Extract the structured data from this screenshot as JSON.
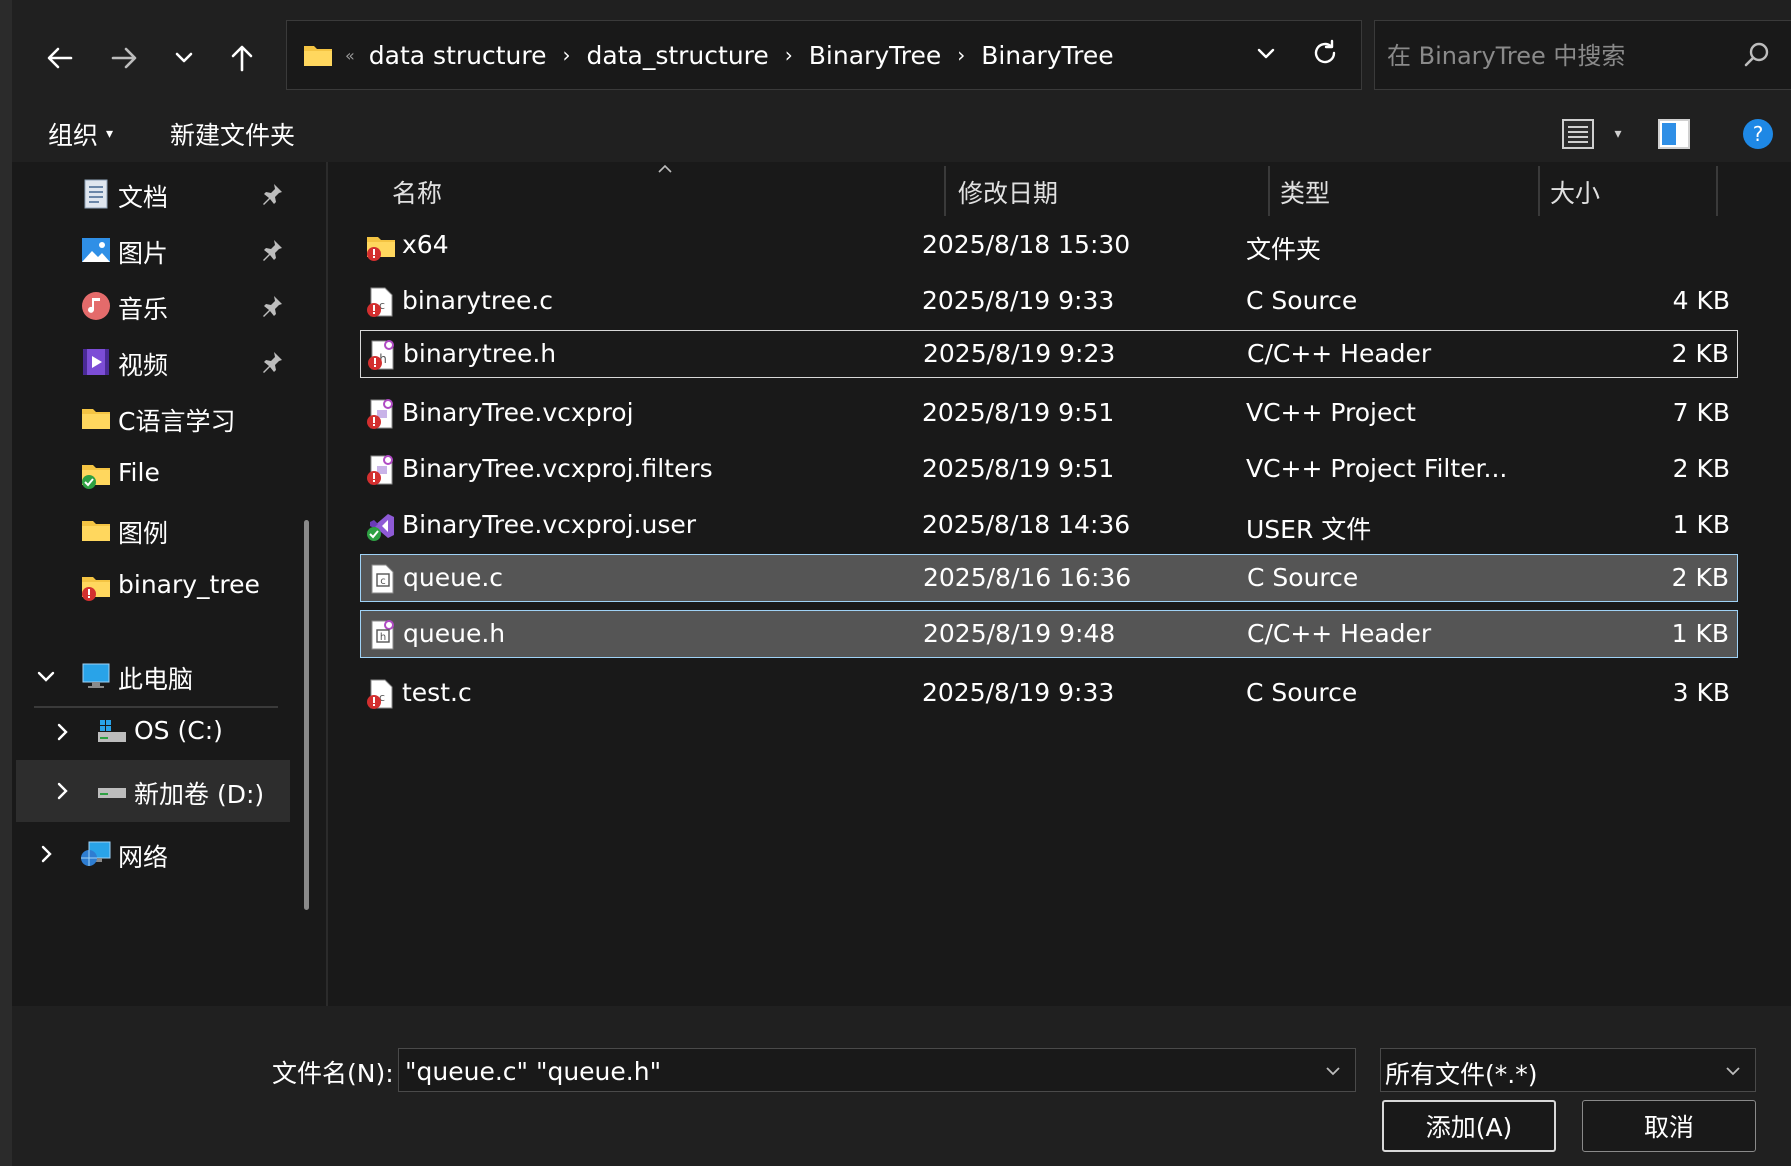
{
  "address": {
    "overflow": "«",
    "crumbs": [
      "data structure",
      "data_structure",
      "BinaryTree",
      "BinaryTree"
    ]
  },
  "search": {
    "placeholder": "在 BinaryTree 中搜索"
  },
  "toolbar": {
    "organize": "组织",
    "new_folder": "新建文件夹"
  },
  "sidebar": {
    "items": [
      {
        "label": "文档"
      },
      {
        "label": "图片"
      },
      {
        "label": "音乐"
      },
      {
        "label": "视频"
      },
      {
        "label": "C语言学习"
      },
      {
        "label": "File"
      },
      {
        "label": "图例"
      },
      {
        "label": "binary_tree"
      },
      {
        "label": "此电脑"
      },
      {
        "label": "OS (C:)"
      },
      {
        "label": "新加卷 (D:)"
      },
      {
        "label": "网络"
      }
    ]
  },
  "columns": {
    "name": "名称",
    "date": "修改日期",
    "type": "类型",
    "size": "大小"
  },
  "files": [
    {
      "name": "x64",
      "date": "2025/8/18 15:30",
      "type": "文件夹",
      "size": ""
    },
    {
      "name": "binarytree.c",
      "date": "2025/8/19 9:33",
      "type": "C Source",
      "size": "4 KB"
    },
    {
      "name": "binarytree.h",
      "date": "2025/8/19 9:23",
      "type": "C/C++ Header",
      "size": "2 KB"
    },
    {
      "name": "BinaryTree.vcxproj",
      "date": "2025/8/19 9:51",
      "type": "VC++ Project",
      "size": "7 KB"
    },
    {
      "name": "BinaryTree.vcxproj.filters",
      "date": "2025/8/19 9:51",
      "type": "VC++ Project Filter...",
      "size": "2 KB"
    },
    {
      "name": "BinaryTree.vcxproj.user",
      "date": "2025/8/18 14:36",
      "type": "USER 文件",
      "size": "1 KB"
    },
    {
      "name": "queue.c",
      "date": "2025/8/16 16:36",
      "type": "C Source",
      "size": "2 KB"
    },
    {
      "name": "queue.h",
      "date": "2025/8/19 9:48",
      "type": "C/C++ Header",
      "size": "1 KB"
    },
    {
      "name": "test.c",
      "date": "2025/8/19 9:33",
      "type": "C Source",
      "size": "3 KB"
    }
  ],
  "bottom": {
    "filename_label": "文件名(N):",
    "filename_value": "\"queue.c\" \"queue.h\"",
    "filetype": "所有文件(*.*)",
    "add_button": "添加(A)",
    "cancel_button": "取消"
  },
  "colors": {
    "accent": "#0078d4",
    "selection_border": "#9fd2f6",
    "background": "#191919"
  }
}
